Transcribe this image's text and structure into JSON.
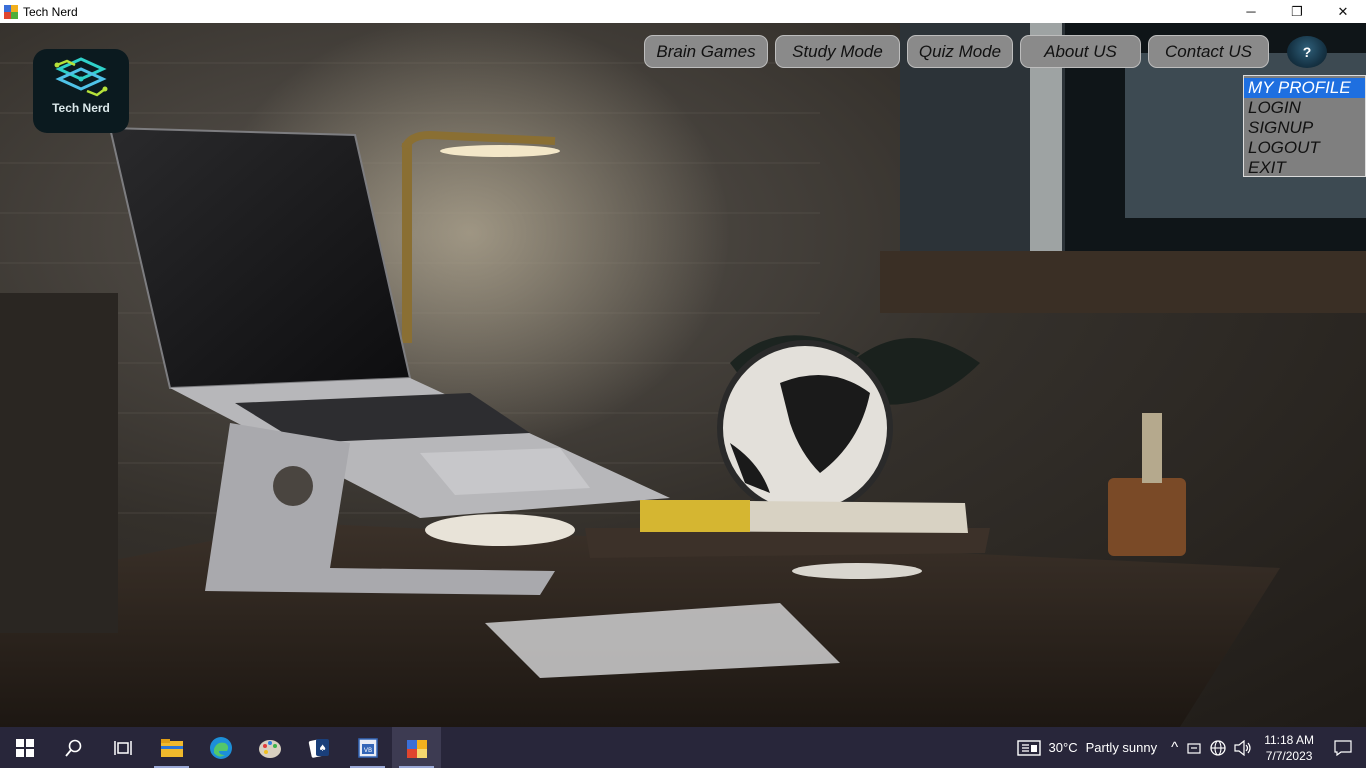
{
  "window": {
    "title": "Tech Nerd",
    "controls": [
      "─",
      "❐",
      "✕"
    ]
  },
  "logo": {
    "text": "Tech Nerd"
  },
  "nav": {
    "items": [
      "Brain Games",
      "Study Mode",
      "Quiz Mode",
      "About US",
      "Contact US"
    ],
    "avatar_glyph": "?"
  },
  "profile_menu": {
    "items": [
      "MY PROFILE",
      "LOGIN",
      "SIGNUP",
      "LOGOUT",
      "EXIT"
    ],
    "selected": "MY PROFILE"
  },
  "taskbar": {
    "apps": [
      "start",
      "search",
      "task-view",
      "file-explorer",
      "edge",
      "paint",
      "solitaire",
      "visual-basic",
      "tech-nerd-app"
    ],
    "weather": {
      "temp": "30°C",
      "condition": "Partly sunny"
    },
    "clock": {
      "time": "11:18 AM",
      "date": "7/7/2023"
    },
    "tray_glyph": "^"
  }
}
